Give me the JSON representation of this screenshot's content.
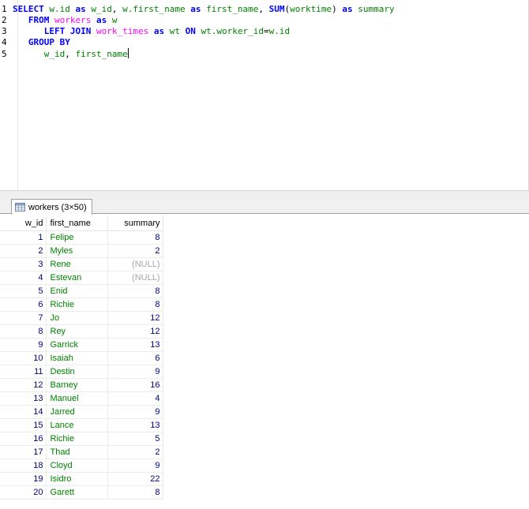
{
  "editor": {
    "lines": [
      {
        "n": "1",
        "tokens": [
          {
            "t": "SELECT",
            "c": "kw"
          },
          {
            "t": " ",
            "c": "sp"
          },
          {
            "t": "w.id",
            "c": "id"
          },
          {
            "t": " ",
            "c": "sp"
          },
          {
            "t": "as",
            "c": "kw"
          },
          {
            "t": " ",
            "c": "sp"
          },
          {
            "t": "w_id",
            "c": "id"
          },
          {
            "t": ", ",
            "c": "tx"
          },
          {
            "t": "w.first_name",
            "c": "id"
          },
          {
            "t": " ",
            "c": "sp"
          },
          {
            "t": "as",
            "c": "kw"
          },
          {
            "t": " ",
            "c": "sp"
          },
          {
            "t": "first_name",
            "c": "id"
          },
          {
            "t": ", ",
            "c": "tx"
          },
          {
            "t": "SUM",
            "c": "fn"
          },
          {
            "t": "(",
            "c": "tx"
          },
          {
            "t": "worktime",
            "c": "id"
          },
          {
            "t": ") ",
            "c": "tx"
          },
          {
            "t": "as",
            "c": "kw"
          },
          {
            "t": " ",
            "c": "sp"
          },
          {
            "t": "summary",
            "c": "id"
          }
        ]
      },
      {
        "n": "2",
        "tokens": [
          {
            "t": "   ",
            "c": "sp"
          },
          {
            "t": "FROM",
            "c": "kw"
          },
          {
            "t": " ",
            "c": "sp"
          },
          {
            "t": "workers",
            "c": "tb"
          },
          {
            "t": " ",
            "c": "sp"
          },
          {
            "t": "as",
            "c": "kw"
          },
          {
            "t": " ",
            "c": "sp"
          },
          {
            "t": "w",
            "c": "id"
          }
        ]
      },
      {
        "n": "3",
        "tokens": [
          {
            "t": "      ",
            "c": "sp"
          },
          {
            "t": "LEFT JOIN",
            "c": "kw"
          },
          {
            "t": " ",
            "c": "sp"
          },
          {
            "t": "work_times",
            "c": "tb"
          },
          {
            "t": " ",
            "c": "sp"
          },
          {
            "t": "as",
            "c": "kw"
          },
          {
            "t": " ",
            "c": "sp"
          },
          {
            "t": "wt",
            "c": "id"
          },
          {
            "t": " ",
            "c": "sp"
          },
          {
            "t": "ON",
            "c": "kw"
          },
          {
            "t": " ",
            "c": "sp"
          },
          {
            "t": "wt.worker_id",
            "c": "id"
          },
          {
            "t": "=",
            "c": "tx"
          },
          {
            "t": "w.id",
            "c": "id"
          }
        ]
      },
      {
        "n": "4",
        "tokens": [
          {
            "t": "   ",
            "c": "sp"
          },
          {
            "t": "GROUP BY",
            "c": "kw"
          }
        ]
      },
      {
        "n": "5",
        "tokens": [
          {
            "t": "      ",
            "c": "sp"
          },
          {
            "t": "w_id",
            "c": "id"
          },
          {
            "t": ", ",
            "c": "tx"
          },
          {
            "t": "first_name",
            "c": "id"
          }
        ],
        "caret": true
      }
    ]
  },
  "results": {
    "tab_label": "workers (3×50)",
    "tab_icon": "table-icon",
    "columns": [
      "w_id",
      "first_name",
      "summary"
    ],
    "rows": [
      [
        "1",
        "Felipe",
        "8"
      ],
      [
        "2",
        "Myles",
        "2"
      ],
      [
        "3",
        "Rene",
        "(NULL)"
      ],
      [
        "4",
        "Estevan",
        "(NULL)"
      ],
      [
        "5",
        "Enid",
        "8"
      ],
      [
        "6",
        "Richie",
        "8"
      ],
      [
        "7",
        "Jo",
        "12"
      ],
      [
        "8",
        "Rey",
        "12"
      ],
      [
        "9",
        "Garrick",
        "13"
      ],
      [
        "10",
        "Isaiah",
        "6"
      ],
      [
        "11",
        "Destin",
        "9"
      ],
      [
        "12",
        "Barney",
        "16"
      ],
      [
        "13",
        "Manuel",
        "4"
      ],
      [
        "14",
        "Jarred",
        "9"
      ],
      [
        "15",
        "Lance",
        "13"
      ],
      [
        "16",
        "Richie",
        "5"
      ],
      [
        "17",
        "Thad",
        "2"
      ],
      [
        "18",
        "Cloyd",
        "9"
      ],
      [
        "19",
        "Isidro",
        "22"
      ],
      [
        "20",
        "Garett",
        "8"
      ]
    ]
  },
  "colors": {
    "keyword": "#0000ff",
    "table_name": "#ff00ff",
    "identifier": "#008000",
    "numeric": "#000080",
    "null": "#a6a6a6"
  }
}
